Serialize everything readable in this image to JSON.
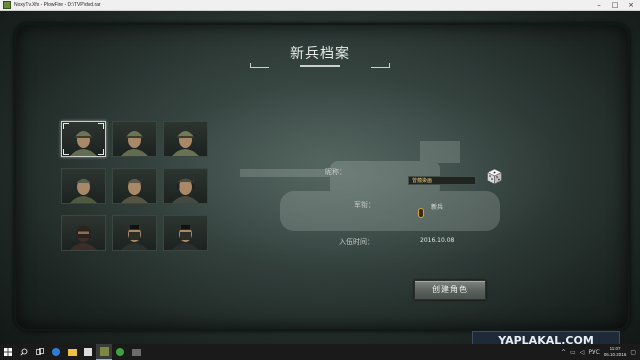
{
  "window": {
    "title": "NoxyTv.Xfx - PlowFire - D:\\TVP\\dvd.rar",
    "controls": [
      "–",
      "□",
      "×"
    ]
  },
  "screen": {
    "title": "新兵档案"
  },
  "avatars": [
    {
      "selected": true,
      "headgear": "helmet",
      "tone": "#6d7556"
    },
    {
      "selected": false,
      "headgear": "helmet",
      "tone": "#6c7453"
    },
    {
      "selected": false,
      "headgear": "helmet",
      "tone": "#737a57"
    },
    {
      "selected": false,
      "headgear": "cap",
      "tone": "#566047"
    },
    {
      "selected": false,
      "headgear": "cap",
      "tone": "#5d5a48"
    },
    {
      "selected": false,
      "headgear": "headset",
      "tone": "#4a4f45"
    },
    {
      "selected": false,
      "headgear": "balaclava",
      "tone": "#3f2f2a"
    },
    {
      "selected": false,
      "headgear": "nvg",
      "tone": "#2f3330"
    },
    {
      "selected": false,
      "headgear": "nvg",
      "tone": "#2c302d"
    }
  ],
  "form": {
    "nickname_label": "昵称：",
    "nickname_value": "曾蕴染画",
    "rank_label": "军衔：",
    "rank_value": "新兵",
    "enlist_label": "入伍时间：",
    "enlist_value": "2016.10.08"
  },
  "create_button": "创建角色",
  "watermark": "YAPLAKAL.COM",
  "taskbar": {
    "icons": [
      "windows-start",
      "search",
      "task-view",
      "edge",
      "file-explorer",
      "store",
      "game-app",
      "green-app",
      "media-app"
    ],
    "tray_lang": "РУС",
    "time": "11:07",
    "date": "06.10.2016"
  },
  "colors": {
    "accent_gold": "#f3d38a",
    "button_gray": "#6a706b"
  }
}
